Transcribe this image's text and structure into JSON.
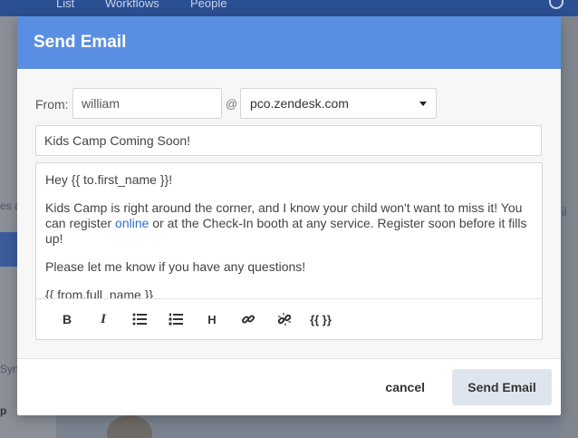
{
  "background": {
    "nav": [
      "...",
      "List",
      "Workflows",
      "People"
    ],
    "sidebar_texts": [
      "es a",
      "Sync",
      "p"
    ],
    "right_link": "il"
  },
  "modal": {
    "title": "Send Email",
    "from_label": "From:",
    "from_value": "william",
    "at_sign": "@",
    "domain_value": "pco.zendesk.com",
    "subject_value": "Kids Camp Coming Soon!",
    "body": {
      "greeting": "Hey {{ to.first_name }}!",
      "para1_before": "Kids Camp is right around the corner, and I know your child won't want to miss it! You can register ",
      "para1_link": "online",
      "para1_after": " or at the Check-In booth at any service. Register soon before it fills up!",
      "para2": "Please let me know if you have any questions!",
      "signature": "{{ from.full_name }}"
    },
    "toolbar": {
      "bold": "B",
      "italic": "I",
      "heading": "H",
      "variables": "{{ }}"
    },
    "cancel_label": "cancel",
    "send_label": "Send Email"
  }
}
